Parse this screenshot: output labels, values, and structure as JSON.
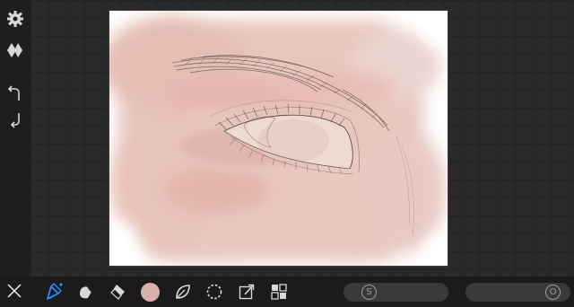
{
  "colors": {
    "accent": "#2a8cff",
    "current_color": "#d9b1aa",
    "icon": "#d8d8d8"
  },
  "left_rail": {
    "items": [
      {
        "icon": "gear-icon"
      },
      {
        "icon": "layers-diamond-icon"
      },
      {
        "icon": "undo-icon"
      },
      {
        "icon": "redo-icon"
      }
    ]
  },
  "bottom_toolbar": {
    "tools": [
      {
        "icon": "close-icon"
      },
      {
        "icon": "pencil-brush-icon",
        "selected": true
      },
      {
        "icon": "smudge-icon"
      },
      {
        "icon": "eraser-icon"
      },
      {
        "icon": "color-swatch-icon"
      },
      {
        "icon": "leaf-icon"
      },
      {
        "icon": "lasso-select-icon"
      },
      {
        "icon": "transform-icon"
      },
      {
        "icon": "grid-layout-icon"
      }
    ],
    "size_slider": {
      "knob_label": "S",
      "level": 0.0
    },
    "opacity_slider": {
      "knob_label": "O",
      "level": 1.0
    }
  },
  "canvas": {
    "subject": "painted-eye-sketch"
  }
}
